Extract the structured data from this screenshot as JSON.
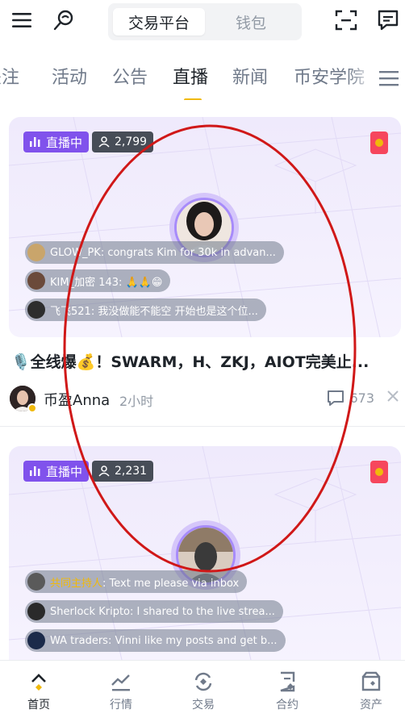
{
  "header": {
    "segments": [
      "交易平台",
      "钱包"
    ],
    "active_segment": 0
  },
  "tabs": {
    "items": [
      "关注",
      "活动",
      "公告",
      "直播",
      "新闻",
      "币安学院"
    ],
    "active": "直播"
  },
  "cards": [
    {
      "live_label": "直播中",
      "viewers": "2,799",
      "comments": [
        {
          "name": "GLOW_PK",
          "text": "congrats Kim for 30k in advan..."
        },
        {
          "name": "KIM_加密 143",
          "text": "🙏🙏😁"
        },
        {
          "name": "飞飞521",
          "text": "我没做能不能空 开始也是这个位..."
        }
      ]
    },
    {
      "live_label": "直播中",
      "viewers": "2,231",
      "comments": [
        {
          "name": "共同主持人",
          "text": "Text me please via inbox"
        },
        {
          "name": "Sherlock Kripto",
          "text": "I shared to the live strea..."
        },
        {
          "name": "WA traders",
          "text": "Vinni like my posts and get b..."
        }
      ]
    }
  ],
  "post": {
    "title": "🎙️全线爆💰！SWARM，H、ZKJ，AIOT完美止...",
    "author": "币盈Anna",
    "time": "2小时",
    "comment_count": "673"
  },
  "bottom_nav": {
    "items": [
      "首页",
      "行情",
      "交易",
      "合约",
      "资产"
    ],
    "active": "首页"
  },
  "colors": {
    "accent": "#f0b90b",
    "live": "#8052ec",
    "annotation": "#d01818"
  }
}
